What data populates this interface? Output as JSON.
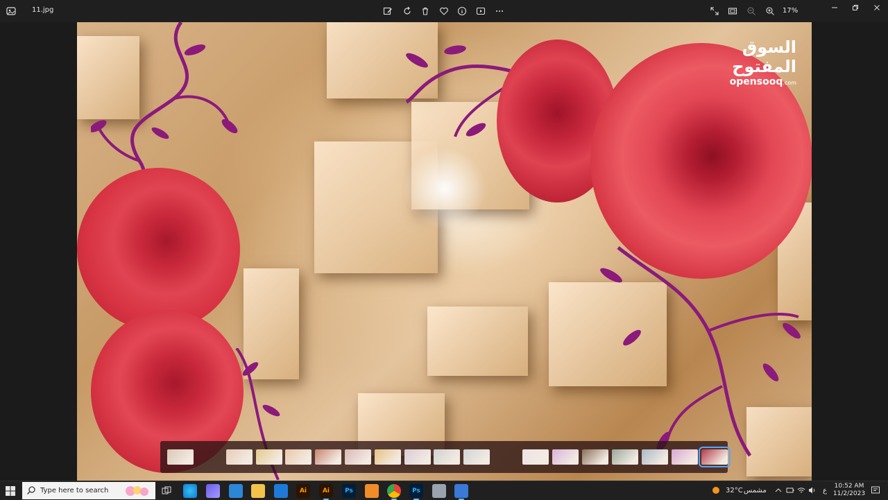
{
  "titlebar": {
    "file_name": "11.jpg",
    "zoom": "17%",
    "toolbar_icons": [
      "edit-image-icon",
      "rotate-icon",
      "delete-icon",
      "favorite-heart-icon",
      "info-icon",
      "slideshow-icon",
      "more-options-icon"
    ],
    "view_icons": [
      "fullscreen-icon",
      "fit-window-icon",
      "zoom-out-icon",
      "zoom-in-icon"
    ],
    "window_controls": [
      "minimize-icon",
      "restore-icon",
      "close-icon"
    ]
  },
  "watermark": {
    "arabic": "السوق المفتوح",
    "latin": "opensooq",
    "suffix": ".com"
  },
  "filmstrip": {
    "thumb_count": 18,
    "selected_index": 17,
    "colors": [
      "#d8c7b4",
      "#e8cbb8",
      "#e3c98a",
      "#e9c7a9",
      "#c98470",
      "#d9b7b7",
      "#e6c182",
      "#d9cbd6",
      "#cfd2cf",
      "#cfd4d6",
      "#ece3e6",
      "#d7b4dc",
      "#8a6f5a",
      "#9aa79a",
      "#a8b9c7",
      "#d9a6d2",
      "#b23a4a"
    ]
  },
  "taskbar": {
    "search_placeholder": "Type here to search",
    "weather": "32°C",
    "weather_label": "مشمس",
    "lang": "ع",
    "time": "10:52 AM",
    "date": "11/2/2023",
    "icons": [
      "start-icon",
      "task-view-icon",
      "edge-icon",
      "app-icon",
      "store-icon",
      "file-explorer-icon",
      "mail-icon",
      "illustrator-icon",
      "illustrator-icon-2",
      "photoshop-icon",
      "app-orange-icon",
      "chrome-icon",
      "photoshop-icon-2",
      "app-gray-icon",
      "photos-icon"
    ]
  },
  "colors": {
    "accent": "#58a6ff",
    "taskbar_bg": "#202020",
    "rose": "#d73a48",
    "vine": "#8b1a7a"
  }
}
